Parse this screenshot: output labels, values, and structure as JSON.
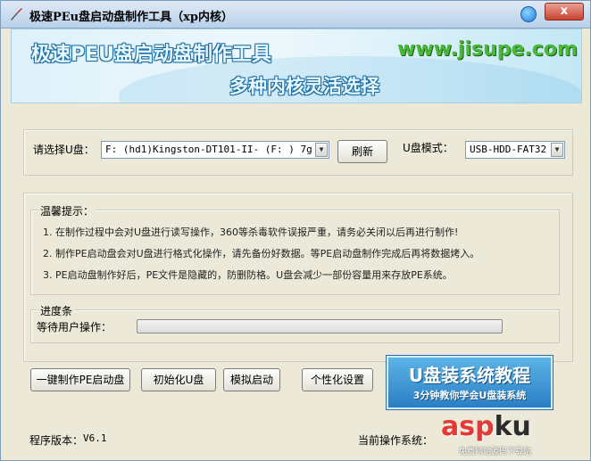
{
  "window": {
    "title": "极速PEu盘启动盘制作工具（xp内核）",
    "close_label": "x"
  },
  "banner": {
    "title": "极速PEU盘启动盘制作工具",
    "url": "www.jisupe.com",
    "subtitle": "多种内核灵活选择"
  },
  "usb_select": {
    "label": "请选择U盘：",
    "value": "F:  (hd1)Kingston-DT101-II-  (F: ) 7g *"
  },
  "refresh_button": "刷新",
  "usb_mode": {
    "label": "U盘模式：",
    "value": "USB-HDD-FAT32"
  },
  "tips": {
    "heading": "温馨提示：",
    "items": [
      "1. 在制作过程中会对U盘进行读写操作，360等杀毒软件误报严重，请务必关闭以后再进行制作!",
      "2. 制作PE启动盘会对U盘进行格式化操作，请先备份好数据。等PE启动盘制作完成后再将数据烤入。",
      "3. PE启动盘制作好后，PE文件是隐藏的，防删防格。U盘会减少一部份容量用来存放PE系统。"
    ]
  },
  "progress": {
    "heading": "进度条",
    "status": "等待用户操作：",
    "fraction": 0
  },
  "buttons": {
    "make": "一键制作PE启动盘",
    "init": "初始化U盘",
    "simulate": "模拟启动",
    "personalize": "个性化设置"
  },
  "promo": {
    "title": "U盘装系统教程",
    "subtitle": "3分钟教你学会U盘装系统"
  },
  "footer": {
    "version_label": "程序版本：",
    "version_value": "V6.1",
    "os_label": "当前操作系统："
  },
  "watermark": {
    "main": "asp",
    "ku": "ku",
    "sub": "免费网站源码下载站"
  }
}
